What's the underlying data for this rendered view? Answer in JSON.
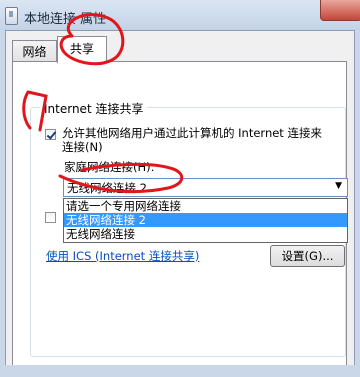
{
  "window": {
    "title": "本地连接 属性"
  },
  "tabs": [
    {
      "label": "网络"
    },
    {
      "label": "共享"
    }
  ],
  "sharing": {
    "group_title": "Internet 连接共享",
    "allow_label": "允许其他网络用户通过此计算机的 Internet 连接来连接(N)",
    "allow_checked": true,
    "home_network_label": "家庭网络连接(H):",
    "combo_value": "无线网络连接 2",
    "dropdown_options": [
      "请选一个专用网络连接",
      "无线网络连接 2",
      "无线网络连接"
    ],
    "selected_option": "无线网络连接 2",
    "ics_link": "使用 ICS (Internet 连接共享)",
    "settings_button": "设置(G)..."
  },
  "colors": {
    "selection": "#3399ff",
    "link": "#0050c0",
    "annotation": "#e0161a"
  }
}
